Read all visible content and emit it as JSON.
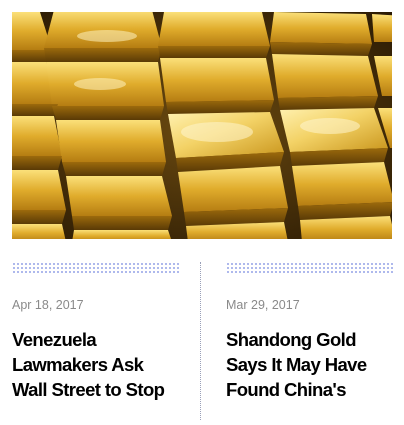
{
  "articles": [
    {
      "date": "Apr 18, 2017",
      "headline": "Venezuela Lawmakers Ask Wall Street to Stop"
    },
    {
      "date": "Mar 29, 2017",
      "headline": "Shandong Gold Says It May Have Found China's"
    }
  ],
  "hero_image": {
    "icon": "gold-bars-photo",
    "colors": {
      "bright_gold": "#f4d35a",
      "mid_gold": "#c9951c",
      "dark_gap": "#3a2606"
    }
  }
}
